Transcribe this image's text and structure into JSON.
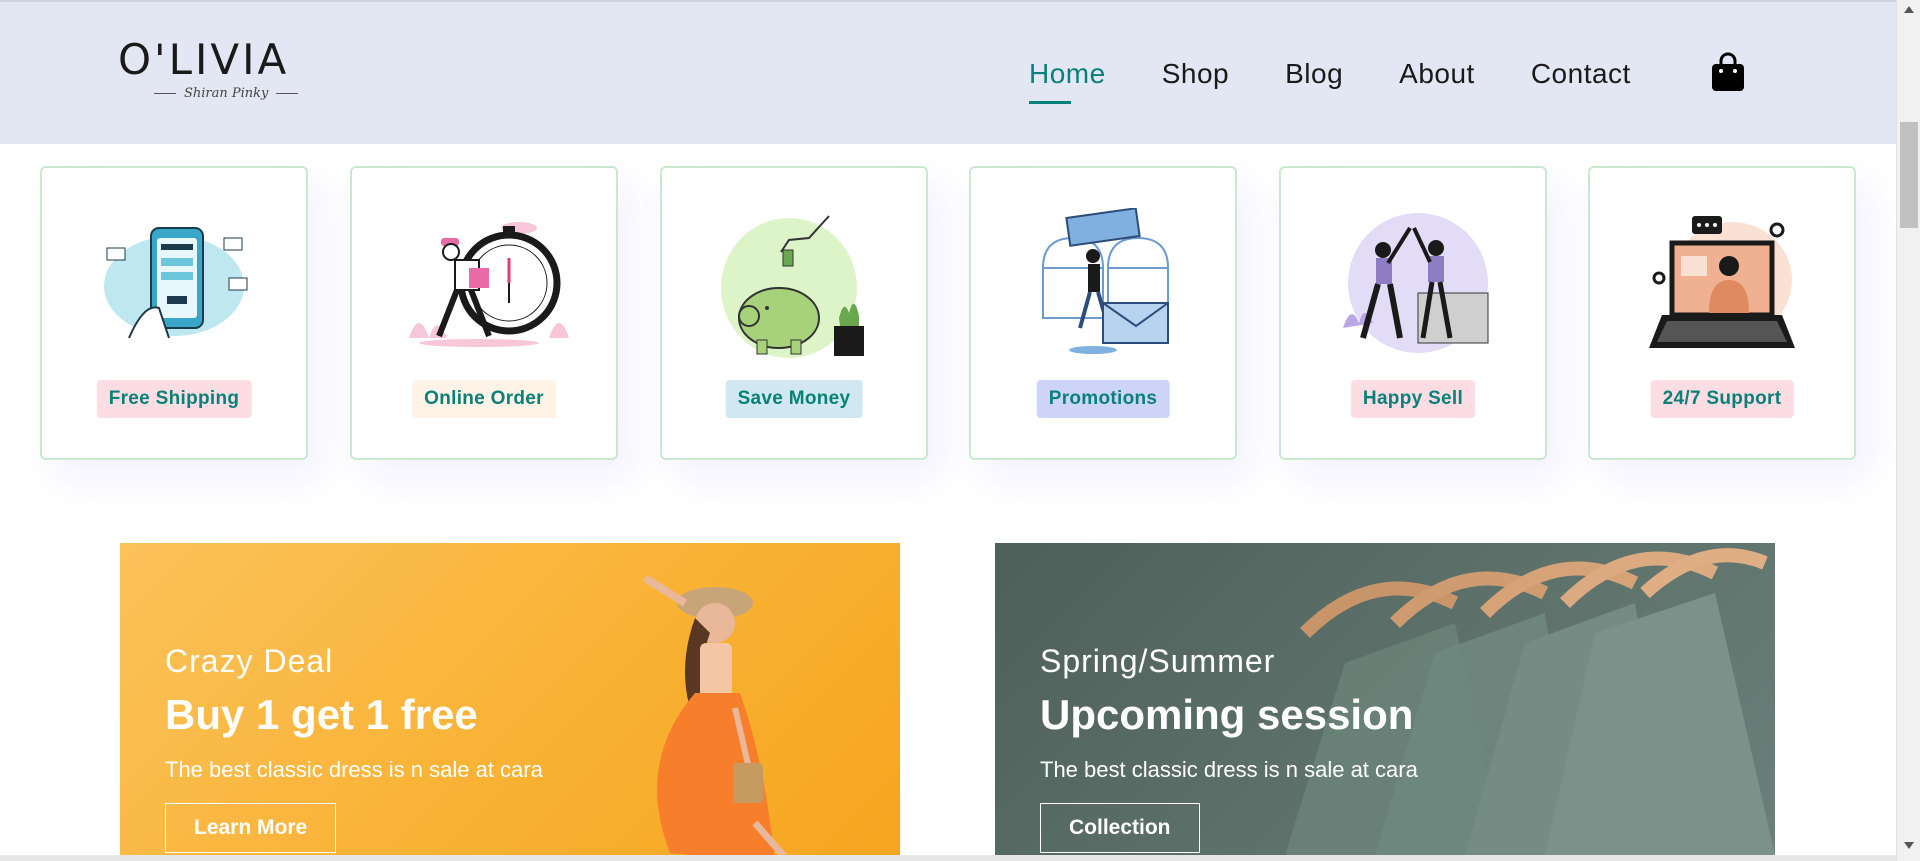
{
  "header": {
    "logo_text": "O'LIVIA",
    "logo_tagline": "Shiran Pinky",
    "nav": [
      "Home",
      "Shop",
      "Blog",
      "About",
      "Contact"
    ],
    "active_nav": "Home",
    "cart_icon": "shopping-bag-icon"
  },
  "features": [
    {
      "label": "Free Shipping",
      "icon": "phone-payment-illustration",
      "badge_color": "#fddde4"
    },
    {
      "label": "Online Order",
      "icon": "stopwatch-courier-illustration",
      "badge_color": "#fff2e6"
    },
    {
      "label": "Save Money",
      "icon": "piggy-bank-illustration",
      "badge_color": "#d1e8f2"
    },
    {
      "label": "Promotions",
      "icon": "gift-voucher-illustration",
      "badge_color": "#cdd4f8"
    },
    {
      "label": "Happy Sell",
      "icon": "high-five-illustration",
      "badge_color": "#fddde4"
    },
    {
      "label": "24/7 Support",
      "icon": "laptop-support-illustration",
      "badge_color": "#fddde4"
    }
  ],
  "banners": [
    {
      "subtitle": "Crazy Deal",
      "title": "Buy 1 get 1 free",
      "description": "The best classic dress is n sale at cara",
      "button": "Learn More"
    },
    {
      "subtitle": "Spring/Summer",
      "title": "Upcoming session",
      "description": "The best classic dress is n sale at cara",
      "button": "Collection"
    }
  ],
  "colors": {
    "accent": "#088178",
    "header_bg": "#e3e6f3",
    "feature_border": "#cce7d0"
  }
}
